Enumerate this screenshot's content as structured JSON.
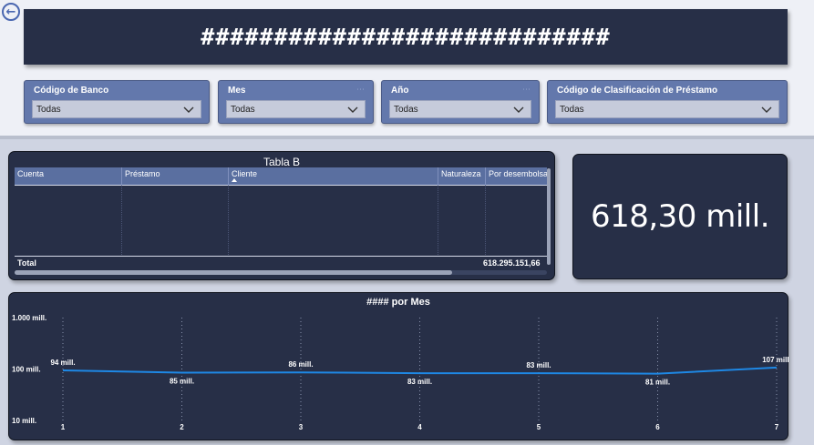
{
  "header": {
    "title": "############################"
  },
  "nav": {
    "back_icon": "arrow-left-circle-icon"
  },
  "filters": [
    {
      "label": "Código de Banco",
      "value": "Todas"
    },
    {
      "label": "Mes",
      "value": "Todas"
    },
    {
      "label": "Año",
      "value": "Todas"
    },
    {
      "label": "Código de Clasificación de Préstamo",
      "value": "Todas"
    }
  ],
  "table": {
    "title": "Tabla B",
    "columns": [
      "Cuenta",
      "Préstamo",
      "Cliente",
      "Naturaleza",
      "Por desembolsar"
    ],
    "sorted_column": "Cliente",
    "total_label": "Total",
    "total_value": "618.295.151,66"
  },
  "kpi": {
    "value": "618,30 mill."
  },
  "chart_data": {
    "type": "line",
    "title": "#### por Mes",
    "x": [
      1,
      2,
      3,
      4,
      5,
      6,
      7
    ],
    "values": [
      94,
      85,
      86,
      83,
      83,
      81,
      107
    ],
    "data_labels": [
      "94 mill.",
      "85 mill.",
      "86 mill.",
      "83 mill.",
      "83 mill.",
      "81 mill.",
      "107 mill."
    ],
    "y_scale": "log",
    "ylim": [
      10,
      1000
    ],
    "y_ticks": [
      {
        "value": 1000,
        "label": "1.000 mill."
      },
      {
        "value": 100,
        "label": "100 mill."
      },
      {
        "value": 10,
        "label": "10 mill."
      }
    ],
    "x_gridlines": "dotted vertical",
    "colors": {
      "line": "#1e88e5",
      "background": "#272f47",
      "text": "#ffffff"
    }
  },
  "theme": {
    "panel": "#272f47",
    "slicer": "#6378ac",
    "table_header": "#5a6fa0",
    "accent_blue": "#4a67b0"
  }
}
